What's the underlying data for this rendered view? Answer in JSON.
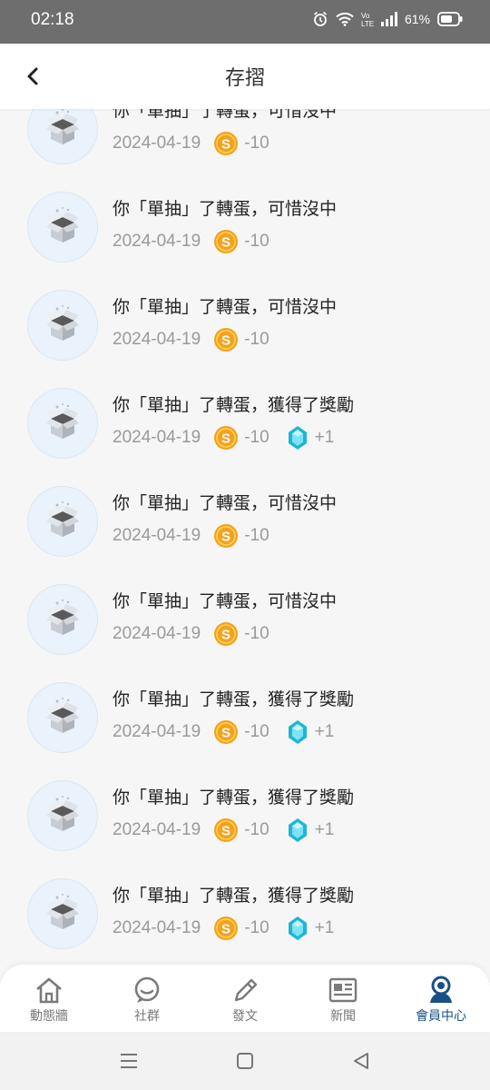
{
  "status": {
    "time": "02:18",
    "battery": "61%",
    "volte": "Vo LTE"
  },
  "header": {
    "title": "存摺",
    "back_icon": "chevron-left-icon"
  },
  "records": [
    {
      "title": "你「單抽」了轉蛋，可惜沒中",
      "date": "2024-04-19",
      "coin": "-10",
      "gem": null
    },
    {
      "title": "你「單抽」了轉蛋，可惜沒中",
      "date": "2024-04-19",
      "coin": "-10",
      "gem": null
    },
    {
      "title": "你「單抽」了轉蛋，可惜沒中",
      "date": "2024-04-19",
      "coin": "-10",
      "gem": null
    },
    {
      "title": "你「單抽」了轉蛋，獲得了獎勵",
      "date": "2024-04-19",
      "coin": "-10",
      "gem": "+1"
    },
    {
      "title": "你「單抽」了轉蛋，可惜沒中",
      "date": "2024-04-19",
      "coin": "-10",
      "gem": null
    },
    {
      "title": "你「單抽」了轉蛋，可惜沒中",
      "date": "2024-04-19",
      "coin": "-10",
      "gem": null
    },
    {
      "title": "你「單抽」了轉蛋，獲得了獎勵",
      "date": "2024-04-19",
      "coin": "-10",
      "gem": "+1"
    },
    {
      "title": "你「單抽」了轉蛋，獲得了獎勵",
      "date": "2024-04-19",
      "coin": "-10",
      "gem": "+1"
    },
    {
      "title": "你「單抽」了轉蛋，獲得了獎勵",
      "date": "2024-04-19",
      "coin": "-10",
      "gem": "+1"
    }
  ],
  "tabs": [
    {
      "label": "動態牆",
      "icon": "home-icon",
      "active": false
    },
    {
      "label": "社群",
      "icon": "chat-bubble-icon",
      "active": false
    },
    {
      "label": "發文",
      "icon": "pencil-icon",
      "active": false
    },
    {
      "label": "新聞",
      "icon": "news-icon",
      "active": false
    },
    {
      "label": "會員中心",
      "icon": "member-icon",
      "active": true
    }
  ],
  "colors": {
    "accent": "#1a4f86",
    "coin": "#f4a21d",
    "gem": "#1fb5d6",
    "meta_text": "#9a9a9a"
  }
}
